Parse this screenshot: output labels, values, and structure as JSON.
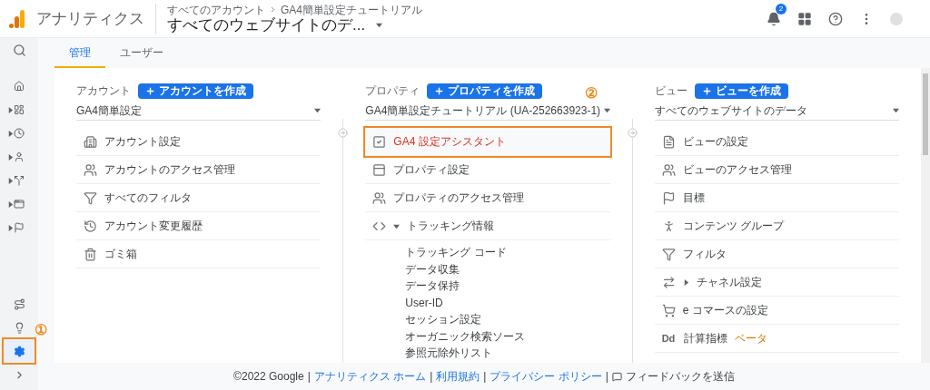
{
  "header": {
    "app_title": "アナリティクス",
    "breadcrumb": [
      "すべてのアカウント",
      "GA4簡単設定チュートリアル"
    ],
    "view_title": "すべてのウェブサイトのデ...",
    "notification_count": "2"
  },
  "sidebar": {
    "top_items": [
      {
        "expandable": false,
        "selected": false
      },
      {
        "expandable": false,
        "selected": false
      },
      {
        "expandable": true,
        "selected": false
      },
      {
        "expandable": true,
        "selected": false
      },
      {
        "expandable": true,
        "selected": false
      },
      {
        "expandable": true,
        "selected": false
      },
      {
        "expandable": true,
        "selected": false
      },
      {
        "expandable": true,
        "selected": false
      }
    ],
    "bottom_items": [
      {
        "selected": false
      },
      {
        "selected": false
      },
      {
        "selected": true,
        "annotation": "①"
      },
      {
        "selected": false
      }
    ]
  },
  "tabs": [
    {
      "label": "管理",
      "selected": true
    },
    {
      "label": "ユーザー",
      "selected": false
    }
  ],
  "columns": [
    {
      "heading": "アカウント",
      "create_button": "アカウントを作成",
      "selector": "GA4簡単設定",
      "items": [
        {
          "label": "アカウント設定"
        },
        {
          "label": "アカウントのアクセス管理"
        },
        {
          "label": "すべてのフィルタ"
        },
        {
          "label": "アカウント変更履歴"
        },
        {
          "label": "ゴミ箱"
        }
      ]
    },
    {
      "heading": "プロパティ",
      "create_button": "プロパティを作成",
      "selector": "GA4簡単設定チュートリアル (UA-252663923-1)",
      "selector_annotation": "②",
      "items": [
        {
          "label": "GA4 設定アシスタント",
          "highlighted": true,
          "annotated": true
        },
        {
          "label": "プロパティ設定",
          "highlighted": false,
          "annotated": false
        },
        {
          "label": "プロパティのアクセス管理",
          "highlighted": false,
          "annotated": false
        },
        {
          "label": "トラッキング情報",
          "highlighted": false,
          "annotated": false,
          "expanded": true,
          "children": [
            {
              "label": "トラッキング コード"
            },
            {
              "label": "データ収集"
            },
            {
              "label": "データ保持"
            },
            {
              "label": "User-ID"
            },
            {
              "label": "セッション設定"
            },
            {
              "label": "オーガニック検索ソース"
            },
            {
              "label": "参照元除外リスト"
            }
          ]
        }
      ]
    },
    {
      "heading": "ビュー",
      "create_button": "ビューを作成",
      "selector": "すべてのウェブサイトのデータ",
      "items": [
        {
          "label": "ビューの設定"
        },
        {
          "label": "ビューのアクセス管理"
        },
        {
          "label": "目標"
        },
        {
          "label": "コンテンツ グループ"
        },
        {
          "label": "フィルタ"
        },
        {
          "label": "チャネル設定",
          "expanded": false
        },
        {
          "label": "e コマースの設定"
        },
        {
          "label": "計算指標",
          "icon_text": "Dd",
          "badge": "ベータ"
        }
      ]
    }
  ],
  "footer": {
    "parts": [
      {
        "kind": "text",
        "text": "©2022 Google"
      },
      {
        "kind": "separator",
        "text": "|"
      },
      {
        "kind": "link",
        "text": "アナリティクス ホーム"
      },
      {
        "kind": "separator",
        "text": "|"
      },
      {
        "kind": "link",
        "text": "利用規約"
      },
      {
        "kind": "separator",
        "text": "|"
      },
      {
        "kind": "link",
        "text": "プライバシー ポリシー"
      },
      {
        "kind": "separator",
        "text": "|"
      },
      {
        "kind": "feedback",
        "text": "フィードバックを送信"
      }
    ]
  }
}
